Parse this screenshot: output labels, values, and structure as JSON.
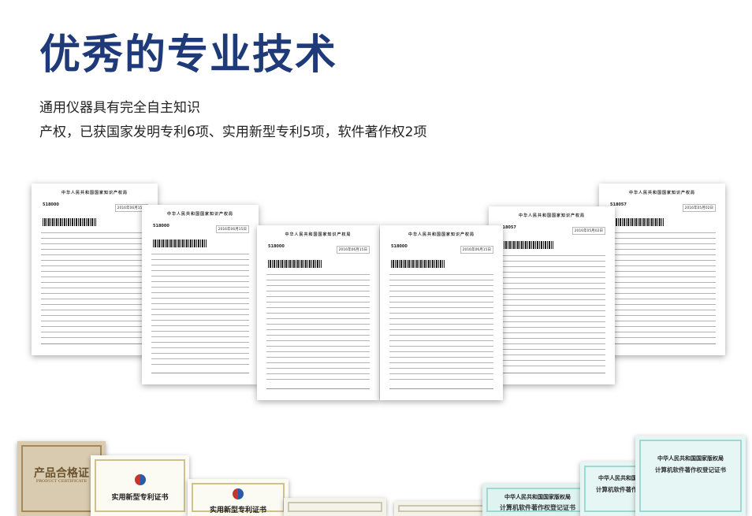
{
  "heading": {
    "title": "优秀的专业技术",
    "line1": "通用仪器具有完全自主知识",
    "line2": "产权，已获国家发明专利6项、实用新型专利5项，软件著作权2项"
  },
  "documents": [
    {
      "header": "中华人民共和国国家知识产权局",
      "number": "518000",
      "stamp": "2016年06月15日"
    },
    {
      "header": "中华人民共和国国家知识产权局",
      "number": "518000",
      "stamp": "2016年06月15日"
    },
    {
      "header": "中华人民共和国国家知识产权局",
      "number": "518000",
      "stamp": "2016年06月15日"
    },
    {
      "header": "中华人民共和国国家知识产权局",
      "number": "518000",
      "stamp": "2016年06月15日"
    },
    {
      "header": "中华人民共和国国家知识产权局",
      "number": "518057",
      "stamp": "2016年05月02日"
    },
    {
      "header": "中华人民共和国国家知识产权局",
      "number": "518057",
      "stamp": "2016年05月02日"
    }
  ],
  "certificates": [
    {
      "title": "产品合格证",
      "subtitle": "PRODUCT CERTIFICATE"
    },
    {
      "title": "实用新型专利证书",
      "subtitle": ""
    },
    {
      "title": "实用新型专利证书",
      "subtitle": ""
    },
    {
      "title": "中华人民共和国国家版权局",
      "subtitle": "计算机软件著作权登记证书"
    },
    {
      "title": "中华人民共和国国家版权局",
      "subtitle": "计算机软件著作权登记证书"
    },
    {
      "title": "中华人民共和国国家版权局",
      "subtitle": "计算机软件著作权登记证书"
    }
  ]
}
